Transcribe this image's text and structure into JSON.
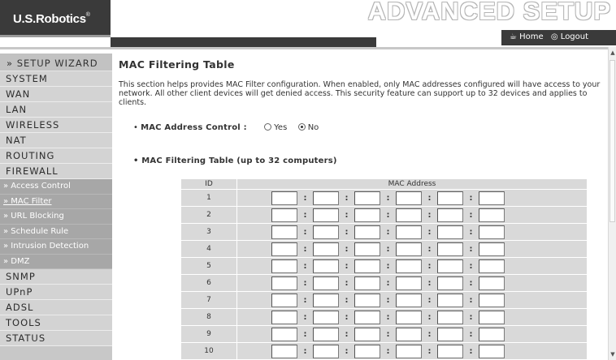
{
  "header": {
    "logo": "U.S.Robotics",
    "logo_mark": "®",
    "banner": "ADVANCED SETUP",
    "home_label": "Home",
    "logout_label": "Logout"
  },
  "sidebar": {
    "wizard": "» SETUP WIZARD",
    "items": [
      "SYSTEM",
      "WAN",
      "LAN",
      "WIRELESS",
      "NAT",
      "ROUTING",
      "FIREWALL"
    ],
    "firewall_sub": [
      "» Access Control",
      "» MAC Filter",
      "» URL Blocking",
      "» Schedule Rule",
      "» Intrusion Detection",
      "» DMZ"
    ],
    "items_after": [
      "SNMP",
      "UPnP",
      "ADSL",
      "TOOLS",
      "STATUS"
    ],
    "active_sub": "» MAC Filter"
  },
  "main": {
    "title": "MAC Filtering Table",
    "description": "This section helps provides MAC Filter configuration. When enabled, only MAC addresses configured will have access to your network. All other client devices will get denied access. This security feature can support up to 32 devices and applies to clients.",
    "control_label": "MAC Address Control :",
    "option_yes": "Yes",
    "option_no": "No",
    "selected_option": "No",
    "table_title": "MAC Filtering Table (up to 32 computers)",
    "table": {
      "col_id": "ID",
      "col_mac": "MAC Address",
      "rows": [
        "1",
        "2",
        "3",
        "4",
        "5",
        "6",
        "7",
        "8",
        "9",
        "10"
      ]
    }
  },
  "colors": {
    "sidebar_bg": "#c8c8c8",
    "sidebar_sub_bg": "#a7a7a7",
    "header_dark": "#3a3a3a",
    "table_cell": "#d9d9d9"
  }
}
